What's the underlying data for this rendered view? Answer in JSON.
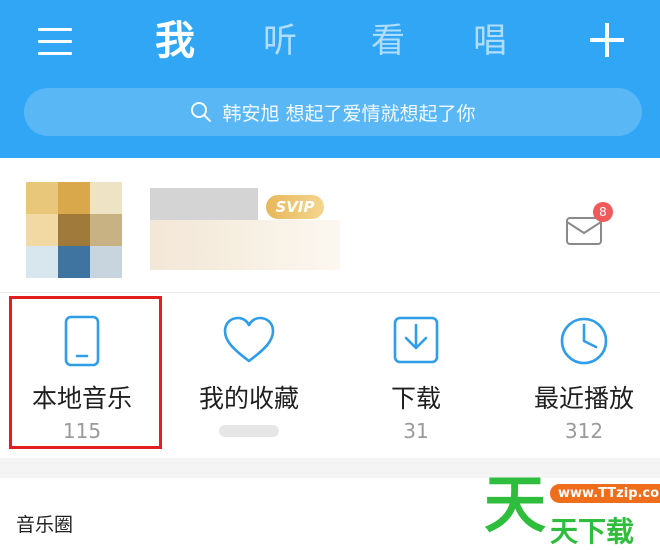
{
  "header": {
    "tabs": [
      {
        "label": "我",
        "active": true
      },
      {
        "label": "听",
        "active": false
      },
      {
        "label": "看",
        "active": false
      },
      {
        "label": "唱",
        "active": false
      }
    ],
    "search_text": "韩安旭 想起了爱情就想起了你",
    "icons": {
      "menu": "menu-icon",
      "add": "plus-icon",
      "search": "search-icon"
    }
  },
  "profile": {
    "vip_badge": "SVIP",
    "message_count": "8",
    "icons": {
      "message": "mail-icon"
    }
  },
  "entries": [
    {
      "label": "本地音乐",
      "count": "115",
      "icon": "phone-icon"
    },
    {
      "label": "我的收藏",
      "count": "",
      "icon": "heart-icon"
    },
    {
      "label": "下载",
      "count": "31",
      "icon": "download-icon"
    },
    {
      "label": "最近播放",
      "count": "312",
      "icon": "clock-icon"
    }
  ],
  "section": {
    "title": "音乐圈"
  },
  "watermark": {
    "char": "天",
    "url": "www.TTzip.com",
    "text": "天下载"
  },
  "colors": {
    "accent": "#31a6f4",
    "highlight": "#e41d1d",
    "badge": "#f05a5a",
    "vip": "#e8b85a"
  }
}
